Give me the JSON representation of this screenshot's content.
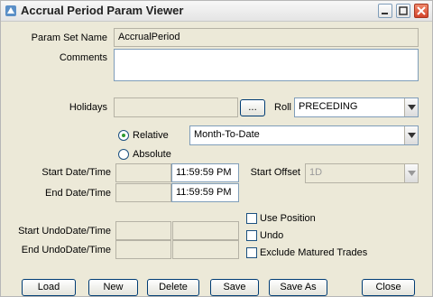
{
  "window": {
    "title": "Accrual Period Param Viewer",
    "icon": "app-icon",
    "controls": [
      "minimize-icon",
      "maximize-icon",
      "close-icon"
    ]
  },
  "form": {
    "param_set_name_label": "Param Set Name",
    "param_set_name_value": "AccrualPeriod",
    "comments_label": "Comments",
    "comments_value": "",
    "holidays_label": "Holidays",
    "holidays_value": "",
    "holidays_browse_label": "...",
    "roll_label": "Roll",
    "roll_value": "PRECEDING",
    "relative_label": "Relative",
    "relative_selected": true,
    "relative_value": "Month-To-Date",
    "absolute_label": "Absolute",
    "start_datetime_label": "Start Date/Time",
    "start_date_value": "",
    "start_time_value": "11:59:59 PM",
    "end_datetime_label": "End Date/Time",
    "end_date_value": "",
    "end_time_value": "11:59:59 PM",
    "start_offset_label": "Start Offset",
    "start_offset_value": "1D",
    "start_undo_label": "Start UndoDate/Time",
    "end_undo_label": "End UndoDate/Time",
    "use_position_label": "Use Position",
    "undo_label": "Undo",
    "exclude_matured_label": "Exclude Matured Trades"
  },
  "buttons": {
    "load": "Load",
    "new": "New",
    "delete": "Delete",
    "save": "Save",
    "save_as": "Save As",
    "close": "Close"
  },
  "colors": {
    "window_bg": "#ECE9D8",
    "field_border": "#7f9db9",
    "radio_dot": "#2f9a2f"
  }
}
